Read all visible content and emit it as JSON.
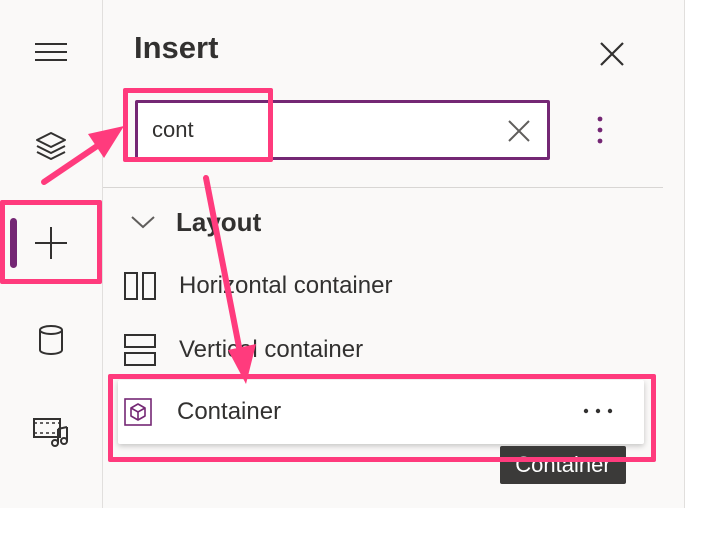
{
  "rail": {
    "items": [
      {
        "name": "menu",
        "icon": "hamburger-icon"
      },
      {
        "name": "tree-view",
        "icon": "layers-icon"
      },
      {
        "name": "insert",
        "icon": "plus-icon",
        "active": true
      },
      {
        "name": "data",
        "icon": "database-icon"
      },
      {
        "name": "media",
        "icon": "media-icon"
      }
    ],
    "active_color": "#742774"
  },
  "panel": {
    "title": "Insert",
    "close_icon": "close-icon",
    "more_icon": "more-vertical-icon"
  },
  "search": {
    "value": "cont",
    "clear_icon": "clear-icon"
  },
  "group": {
    "label": "Layout",
    "expanded": true,
    "items": [
      {
        "label": "Horizontal container",
        "icon": "horizontal-container-icon"
      },
      {
        "label": "Vertical container",
        "icon": "vertical-container-icon"
      },
      {
        "label": "Container",
        "icon": "container-icon",
        "selected": true
      }
    ]
  },
  "tooltip": {
    "text": "Container"
  },
  "annotations": {
    "callout_color": "#ff3b7d"
  }
}
